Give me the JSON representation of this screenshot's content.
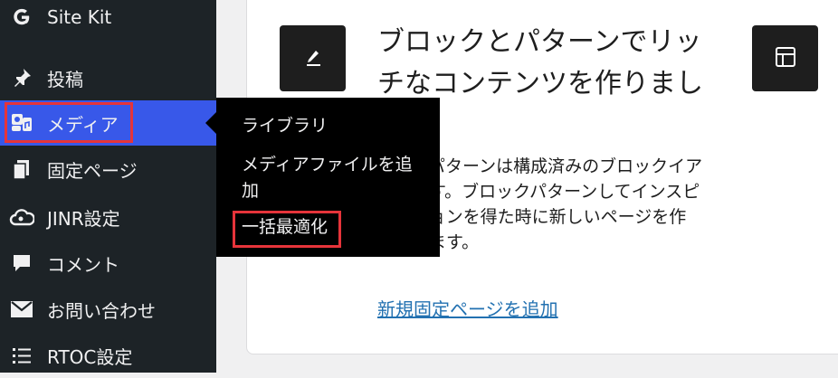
{
  "sidebar": {
    "items": [
      {
        "label": "Site Kit",
        "icon": "google-g-icon"
      },
      {
        "label": "投稿",
        "icon": "pin-icon"
      },
      {
        "label": "メディア",
        "icon": "media-icon"
      },
      {
        "label": "固定ページ",
        "icon": "page-icon"
      },
      {
        "label": "JINR設定",
        "icon": "cloud-icon"
      },
      {
        "label": "コメント",
        "icon": "comment-icon"
      },
      {
        "label": "お問い合わせ",
        "icon": "mail-icon"
      },
      {
        "label": "RTOC設定",
        "icon": "list-icon"
      }
    ],
    "active_color": "#3858e9"
  },
  "flyout": {
    "items": [
      "ライブラリ",
      "メディアファイルを追加",
      "一括最適化"
    ]
  },
  "main": {
    "heading": "ブロックとパターンでリッチなコンテンツを作りまし",
    "description": "ロックパターンは構成済みのブロックイアウトです。ブロックパターンしてインスピレーションを得た時に新しいページを作成できます。",
    "link": "新規固定ページを追加"
  },
  "highlight_color": "#e6343a"
}
